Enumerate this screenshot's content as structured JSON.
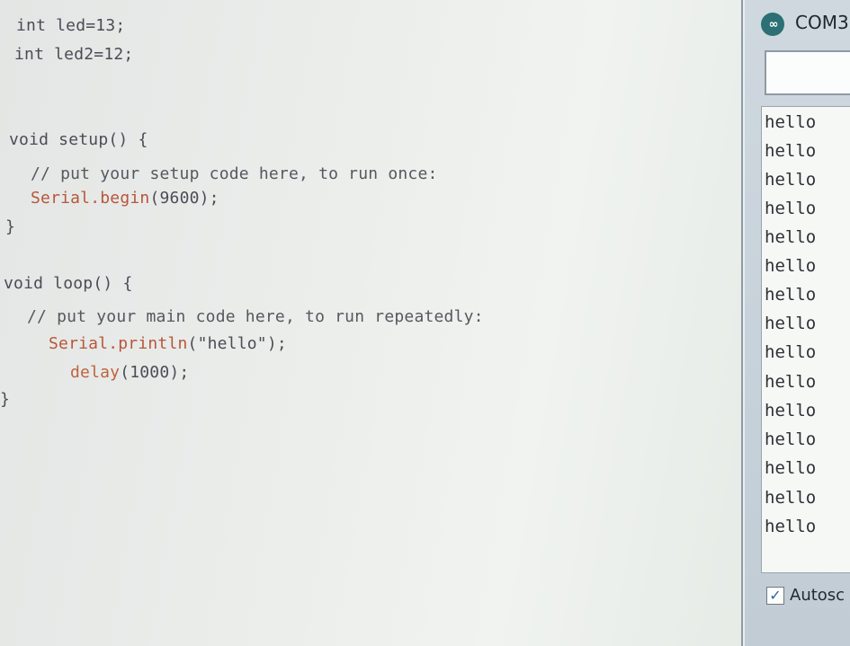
{
  "editor": {
    "lines": [
      {
        "parts": [
          {
            "t": "int led=13;",
            "c": "kw"
          }
        ]
      },
      {
        "parts": [
          {
            "t": "int led2=12;",
            "c": "kw"
          }
        ]
      },
      {
        "parts": [
          {
            "t": "void setup() {",
            "c": "kw"
          }
        ]
      },
      {
        "parts": [
          {
            "t": "// put your setup code here, to run once:",
            "c": "cm"
          }
        ]
      },
      {
        "parts": [
          {
            "t": "Serial.begin",
            "c": "fn"
          },
          {
            "t": "(9600);",
            "c": "kw"
          }
        ]
      },
      {
        "parts": [
          {
            "t": "}",
            "c": "kw"
          }
        ]
      },
      {
        "parts": [
          {
            "t": "void loop() {",
            "c": "kw"
          }
        ]
      },
      {
        "parts": [
          {
            "t": "// put your main code here, to run repeatedly:",
            "c": "cm"
          }
        ]
      },
      {
        "parts": [
          {
            "t": "Serial.println",
            "c": "fn"
          },
          {
            "t": "(\"hello\");",
            "c": "kw"
          }
        ]
      },
      {
        "parts": [
          {
            "t": "delay",
            "c": "fn2"
          },
          {
            "t": "(1000);",
            "c": "kw"
          }
        ]
      },
      {
        "parts": [
          {
            "t": "}",
            "c": "kw"
          }
        ]
      }
    ]
  },
  "monitor": {
    "title": "COM3",
    "logo_text": "∞",
    "send_input_value": "",
    "output_lines": [
      "hello",
      "hello",
      "hello",
      "hello",
      "hello",
      "hello",
      "hello",
      "hello",
      "hello",
      "hello",
      "hello",
      "hello",
      "hello",
      "hello",
      "hello"
    ],
    "autoscroll_label": "Autosc",
    "autoscroll_checked": true
  }
}
